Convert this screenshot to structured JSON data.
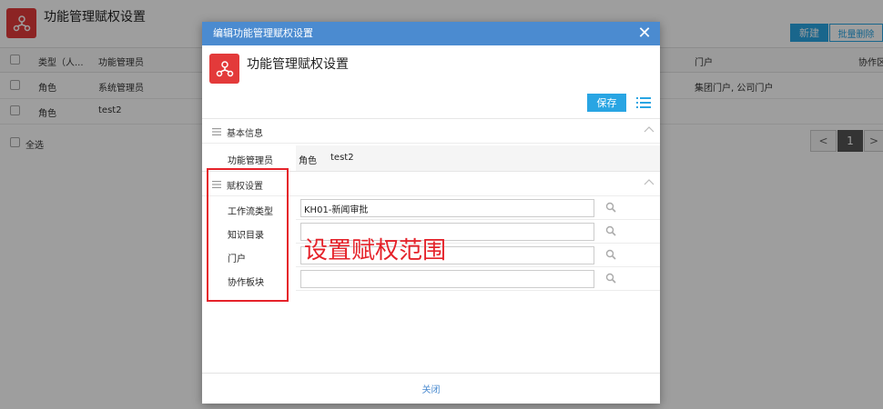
{
  "background": {
    "title": "功能管理赋权设置",
    "buttons": {
      "new": "新建",
      "batch_delete": "批量删除"
    },
    "columns": {
      "type": "类型（人...",
      "manager": "功能管理员",
      "portal": "门户",
      "collab": "协作区"
    },
    "rows": [
      {
        "type": "角色",
        "manager": "系统管理员",
        "portal": "集团门户, 公司门户"
      },
      {
        "type": "角色",
        "manager": "test2",
        "portal": ""
      }
    ],
    "select_all": "全选",
    "pager": {
      "prev": "<",
      "current": "1",
      "next": ">"
    }
  },
  "dialog": {
    "window_title": "编辑功能管理赋权设置",
    "close_symbol": "✕",
    "heading": "功能管理赋权设置",
    "save": "保存",
    "basic_section": "基本信息",
    "manager_label": "功能管理员",
    "manager_type": "角色",
    "manager_value": "test2",
    "rights_section": "赋权设置",
    "fields": [
      {
        "label": "工作流类型",
        "value": "KH01-新闻审批"
      },
      {
        "label": "知识目录",
        "value": ""
      },
      {
        "label": "门户",
        "value": ""
      },
      {
        "label": "协作板块",
        "value": ""
      }
    ],
    "annotation": "设置赋权范围",
    "footer_close": "关闭"
  },
  "colors": {
    "accent": "#29a5e3",
    "titlebar": "#4b8bd0",
    "logo": "#e33a3a",
    "annotation": "#e5222a"
  },
  "icons": [
    "app-logo-icon",
    "close-icon",
    "list-icon",
    "hamburger-icon",
    "chevron-up-icon",
    "search-icon"
  ]
}
